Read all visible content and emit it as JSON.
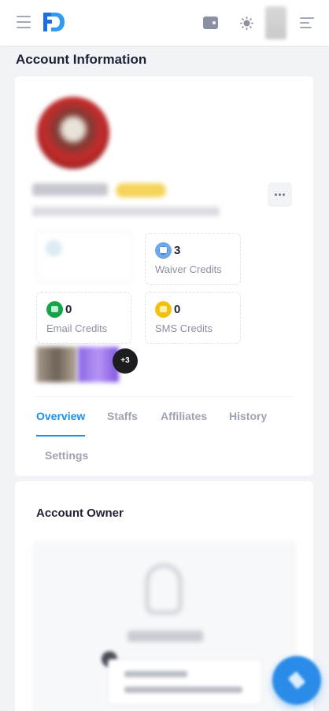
{
  "header": {
    "logo_text": "FD",
    "icons": [
      "menu-icon",
      "logo",
      "wallet-icon",
      "sun-icon",
      "user-avatar",
      "right-menu-icon"
    ],
    "accent": "#1b8ee6"
  },
  "page": {
    "title": "Account Information"
  },
  "account": {
    "credits": [
      {
        "id": "waiver",
        "value": "3",
        "label": "Waiver Credits",
        "icon": "waiver-credit-icon",
        "color": "#3b82f6"
      },
      {
        "id": "email",
        "value": "0",
        "label": "Email Credits",
        "icon": "email-credit-icon",
        "color": "#16a34a"
      },
      {
        "id": "sms",
        "value": "0",
        "label": "SMS Credits",
        "icon": "sms-credit-icon",
        "color": "#f2c011"
      }
    ],
    "more_images": "+3"
  },
  "tabs": [
    {
      "label": "Overview",
      "active": true
    },
    {
      "label": "Staffs",
      "active": false
    },
    {
      "label": "Affiliates",
      "active": false
    },
    {
      "label": "History",
      "active": false
    },
    {
      "label": "Settings",
      "active": false
    }
  ],
  "owner": {
    "title": "Account Owner"
  },
  "fab": {
    "icon": "edit-icon",
    "color": "#2a8ce8"
  }
}
